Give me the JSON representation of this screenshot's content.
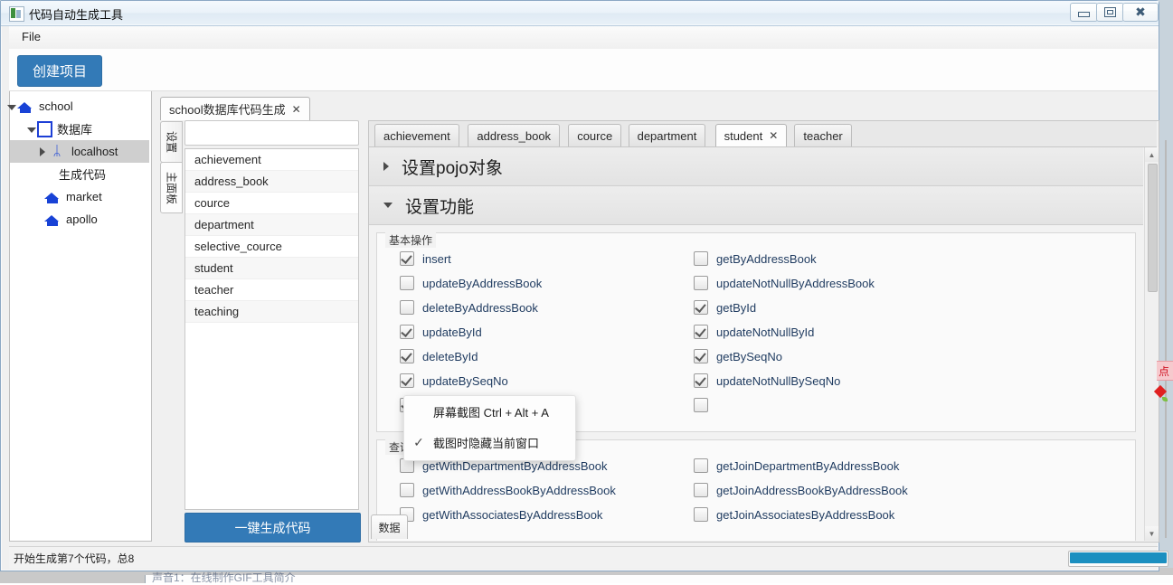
{
  "window": {
    "title": "代码自动生成工具",
    "icon": "app-icon",
    "controls": {
      "minimize": "minimize-icon",
      "maximize": "maximize-icon",
      "close": "close-icon"
    }
  },
  "menubar": {
    "items": [
      "File"
    ]
  },
  "toolbar": {
    "create_project_label": "创建项目"
  },
  "tree": {
    "nodes": [
      {
        "label": "school",
        "icon": "home-icon",
        "indent": 8,
        "expander": "triangle-down",
        "selected": false
      },
      {
        "label": "数据库",
        "icon": "database-icon",
        "indent": 30,
        "expander": "triangle-down",
        "selected": false
      },
      {
        "label": "localhost",
        "icon": "bluetooth-icon",
        "indent": 44,
        "expander": "triangle-right",
        "selected": true
      },
      {
        "label": "生成代码",
        "icon": "none",
        "indent": 54,
        "expander": "none",
        "selected": false
      },
      {
        "label": "market",
        "icon": "home-icon",
        "indent": 38,
        "expander": "none",
        "selected": false
      },
      {
        "label": "apollo",
        "icon": "home-icon",
        "indent": 38,
        "expander": "none",
        "selected": false
      }
    ]
  },
  "side_tabs": [
    {
      "label": "设置",
      "active": false
    },
    {
      "label": "主面板",
      "active": true
    }
  ],
  "table_list": {
    "search_value": "",
    "search_placeholder": "",
    "items": [
      "achievement",
      "address_book",
      "cource",
      "department",
      "selective_cource",
      "student",
      "teacher",
      "teaching"
    ],
    "generate_button": "一键生成代码"
  },
  "document_tabs": [
    {
      "label": "school数据库代码生成",
      "closable": true,
      "active": true
    }
  ],
  "content_tabs": [
    {
      "label": "achievement",
      "closable": false,
      "active": false
    },
    {
      "label": "address_book",
      "closable": false,
      "active": false
    },
    {
      "label": "cource",
      "closable": false,
      "active": false
    },
    {
      "label": "department",
      "closable": false,
      "active": false
    },
    {
      "label": "student",
      "closable": true,
      "active": true
    },
    {
      "label": "teacher",
      "closable": false,
      "active": false
    }
  ],
  "accordions": [
    {
      "title": "设置pojo对象",
      "expanded": false,
      "arrow": "triangle-right"
    },
    {
      "title": "设置功能",
      "expanded": true,
      "arrow": "triangle-down"
    }
  ],
  "groups": [
    {
      "title": "基本操作",
      "rows": [
        {
          "left": {
            "label": "insert",
            "checked": true
          },
          "right": {
            "label": "getByAddressBook",
            "checked": false
          }
        },
        {
          "left": {
            "label": "updateByAddressBook",
            "checked": false
          },
          "right": {
            "label": "updateNotNullByAddressBook",
            "checked": false
          }
        },
        {
          "left": {
            "label": "deleteByAddressBook",
            "checked": false
          },
          "right": {
            "label": "getById",
            "checked": true
          }
        },
        {
          "left": {
            "label": "updateById",
            "checked": true
          },
          "right": {
            "label": "updateNotNullById",
            "checked": true
          }
        },
        {
          "left": {
            "label": "deleteById",
            "checked": true
          },
          "right": {
            "label": "getBySeqNo",
            "checked": true
          }
        },
        {
          "left": {
            "label": "updateBySeqNo",
            "checked": true
          },
          "right": {
            "label": "updateNotNullBySeqNo",
            "checked": true
          }
        },
        {
          "left": {
            "label": "",
            "checked": true
          },
          "right": {
            "label": "",
            "checked": false
          }
        }
      ]
    },
    {
      "title": "查询关",
      "rows": [
        {
          "left": {
            "label": "getWithDepartmentByAddressBook",
            "checked": false
          },
          "right": {
            "label": "getJoinDepartmentByAddressBook",
            "checked": false
          }
        },
        {
          "left": {
            "label": "getWithAddressBookByAddressBook",
            "checked": false
          },
          "right": {
            "label": "getJoinAddressBookByAddressBook",
            "checked": false
          }
        },
        {
          "left": {
            "label": "getWithAssociatesByAddressBook",
            "checked": false
          },
          "right": {
            "label": "getJoinAssociatesByAddressBook",
            "checked": false
          }
        }
      ]
    }
  ],
  "bottom_tab": {
    "label": "数据"
  },
  "context_menu": {
    "items": [
      {
        "label": "屏幕截图 Ctrl + Alt + A",
        "checked": false
      },
      {
        "label": "截图时隐藏当前窗口",
        "checked": true
      }
    ]
  },
  "statusbar": {
    "text": "开始生成第7个代码，总8",
    "progress_percent": 100,
    "progress_color": "#1b8fc0"
  },
  "floating_widget": {
    "tip_text": "点",
    "pin_icon": "pin-icon"
  },
  "desktop": {
    "background_text": "声音1：在线制作GIF工具简介"
  },
  "colors": {
    "accent": "#337ab7",
    "selection": "#cfcfcf",
    "progress": "#1b8fc0",
    "tree_icon": "#1842d6",
    "label_text": "#1e3a5f"
  }
}
